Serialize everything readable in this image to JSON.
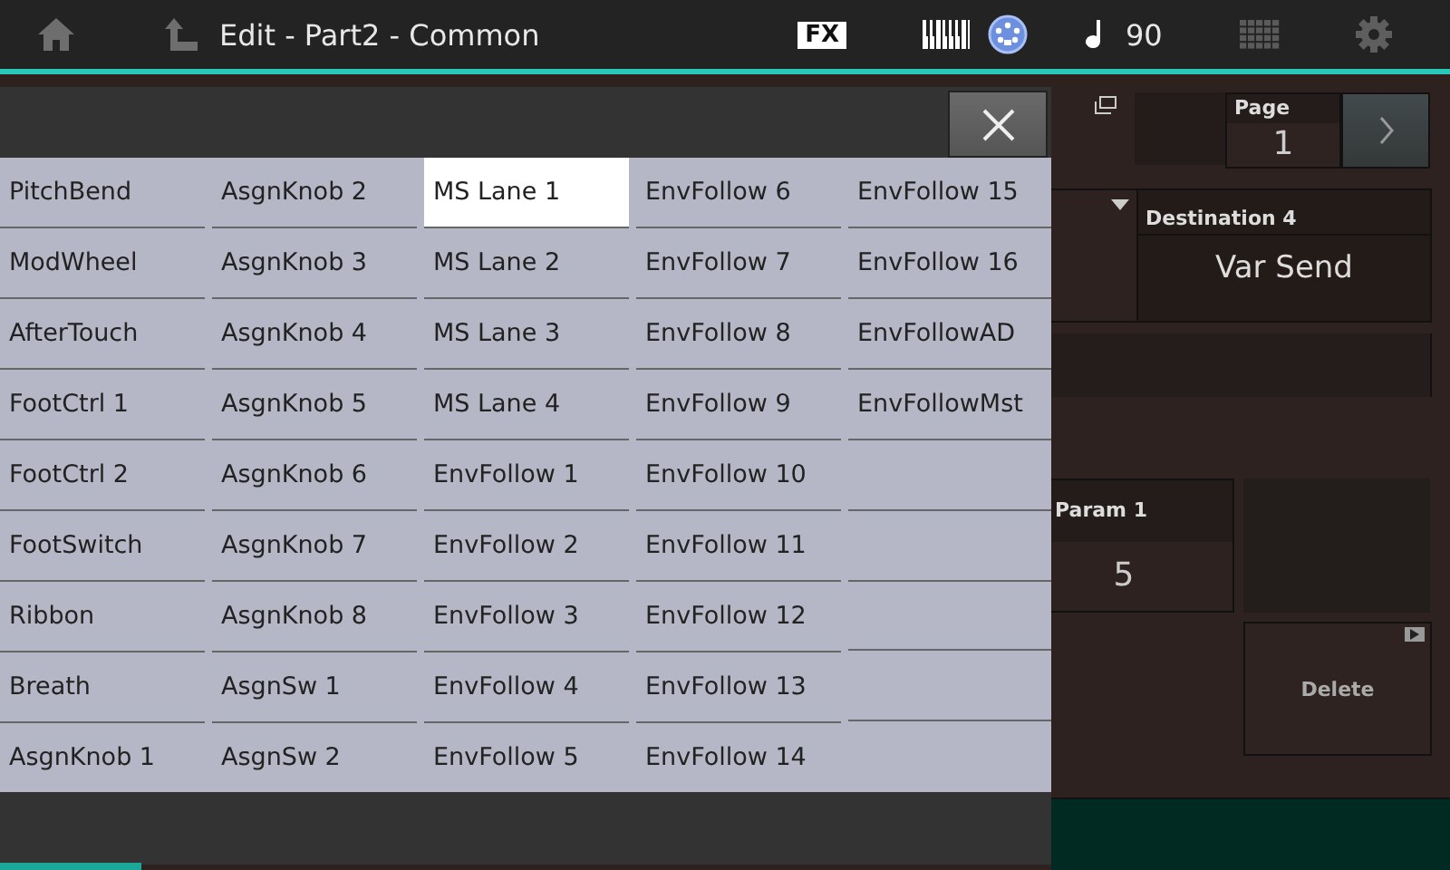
{
  "top_bar": {
    "title": "Edit - Part2 - Common",
    "fx_badge": "FX",
    "tempo": "90"
  },
  "selector": {
    "columns": [
      {
        "items": [
          {
            "label": "PitchBend",
            "selected": false
          },
          {
            "label": "ModWheel",
            "selected": false
          },
          {
            "label": "AfterTouch",
            "selected": false
          },
          {
            "label": "FootCtrl 1",
            "selected": false
          },
          {
            "label": "FootCtrl 2",
            "selected": false
          },
          {
            "label": "FootSwitch",
            "selected": false
          },
          {
            "label": "Ribbon",
            "selected": false
          },
          {
            "label": "Breath",
            "selected": false
          },
          {
            "label": "AsgnKnob 1",
            "selected": false
          }
        ]
      },
      {
        "items": [
          {
            "label": "AsgnKnob 2",
            "selected": false
          },
          {
            "label": "AsgnKnob 3",
            "selected": false
          },
          {
            "label": "AsgnKnob 4",
            "selected": false
          },
          {
            "label": "AsgnKnob 5",
            "selected": false
          },
          {
            "label": "AsgnKnob 6",
            "selected": false
          },
          {
            "label": "AsgnKnob 7",
            "selected": false
          },
          {
            "label": "AsgnKnob 8",
            "selected": false
          },
          {
            "label": "AsgnSw 1",
            "selected": false
          },
          {
            "label": "AsgnSw 2",
            "selected": false
          }
        ]
      },
      {
        "items": [
          {
            "label": "MS Lane 1",
            "selected": true
          },
          {
            "label": "MS Lane 2",
            "selected": false
          },
          {
            "label": "MS Lane 3",
            "selected": false
          },
          {
            "label": "MS Lane 4",
            "selected": false
          },
          {
            "label": "EnvFollow 1",
            "selected": false
          },
          {
            "label": "EnvFollow 2",
            "selected": false
          },
          {
            "label": "EnvFollow 3",
            "selected": false
          },
          {
            "label": "EnvFollow 4",
            "selected": false
          },
          {
            "label": "EnvFollow 5",
            "selected": false
          }
        ]
      },
      {
        "items": [
          {
            "label": "EnvFollow 6",
            "selected": false
          },
          {
            "label": "EnvFollow 7",
            "selected": false
          },
          {
            "label": "EnvFollow 8",
            "selected": false
          },
          {
            "label": "EnvFollow 9",
            "selected": false
          },
          {
            "label": "EnvFollow 10",
            "selected": false
          },
          {
            "label": "EnvFollow 11",
            "selected": false
          },
          {
            "label": "EnvFollow 12",
            "selected": false
          },
          {
            "label": "EnvFollow 13",
            "selected": false
          },
          {
            "label": "EnvFollow 14",
            "selected": false
          }
        ]
      },
      {
        "items": [
          {
            "label": "EnvFollow 15",
            "selected": false
          },
          {
            "label": "EnvFollow 16",
            "selected": false
          },
          {
            "label": "EnvFollowAD",
            "selected": false
          },
          {
            "label": "EnvFollowMst",
            "selected": false
          }
        ]
      }
    ]
  },
  "page": {
    "label": "Page",
    "value": "1"
  },
  "destination": {
    "label": "Destination 4",
    "value": "Var Send"
  },
  "param": {
    "label": "Param 1",
    "value": "5"
  },
  "delete_button": "Delete"
}
